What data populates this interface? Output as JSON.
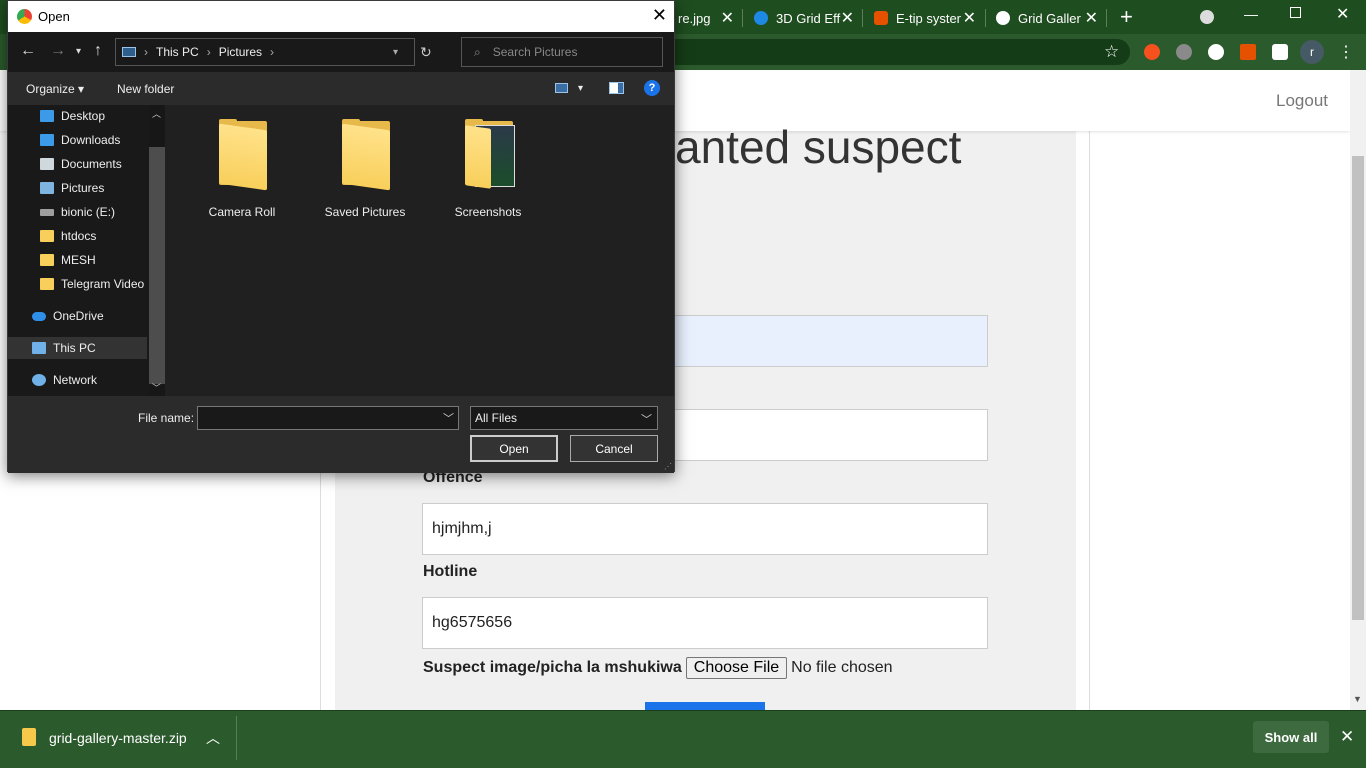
{
  "browser": {
    "tabs": [
      {
        "label": "re.jpg",
        "color": "#ffffff"
      },
      {
        "label": "3D Grid Eff",
        "color": "#1e88e5"
      },
      {
        "label": "E-tip syster",
        "color": "#e65100"
      },
      {
        "label": "Grid Galler",
        "color": "#ffffff"
      }
    ],
    "new_tab": "+"
  },
  "page": {
    "logout": "Logout",
    "heading": "anted suspect",
    "label_offence": "Offence",
    "value_offence": "hjmjhm,j",
    "label_hotline": "Hotline",
    "value_hotline": "hg6575656",
    "label_image": "Suspect image/picha la mshukiwa",
    "choose_file": "Choose File",
    "no_file": "No file chosen"
  },
  "dialog": {
    "title": "Open",
    "breadcrumb": [
      "This PC",
      "Pictures"
    ],
    "search_placeholder": "Search Pictures",
    "organize": "Organize",
    "new_folder": "New folder",
    "nav_items": [
      {
        "label": "Desktop",
        "pinned": true,
        "icon": "desktop-icon",
        "color": "#3b9be8"
      },
      {
        "label": "Downloads",
        "pinned": true,
        "icon": "download-icon",
        "color": "#3b9be8"
      },
      {
        "label": "Documents",
        "pinned": true,
        "icon": "document-icon",
        "color": "#cfd8dc"
      },
      {
        "label": "Pictures",
        "pinned": true,
        "icon": "pictures-icon",
        "color": "#7fb3e0"
      },
      {
        "label": "bionic (E:)",
        "pinned": false,
        "icon": "drive-icon",
        "color": "#9e9e9e"
      },
      {
        "label": "htdocs",
        "pinned": false,
        "icon": "folder-icon",
        "color": "#f8cf5b"
      },
      {
        "label": "MESH",
        "pinned": false,
        "icon": "folder-icon",
        "color": "#f8cf5b"
      },
      {
        "label": "Telegram Video",
        "pinned": false,
        "icon": "folder-icon",
        "color": "#f8cf5b"
      },
      {
        "label": "OneDrive",
        "pinned": false,
        "icon": "cloud-icon",
        "color": "#2f8fe8"
      },
      {
        "label": "This PC",
        "pinned": false,
        "icon": "computer-icon",
        "color": "#6fb1e8"
      },
      {
        "label": "Network",
        "pinned": false,
        "icon": "network-icon",
        "color": "#6fb1e8"
      }
    ],
    "folders": [
      "Camera Roll",
      "Saved Pictures",
      "Screenshots"
    ],
    "file_name_label": "File name:",
    "file_name_value": "",
    "file_type": "All Files",
    "open_button": "Open",
    "cancel_button": "Cancel"
  },
  "downloads": {
    "file": "grid-gallery-master.zip",
    "show_all": "Show all"
  }
}
